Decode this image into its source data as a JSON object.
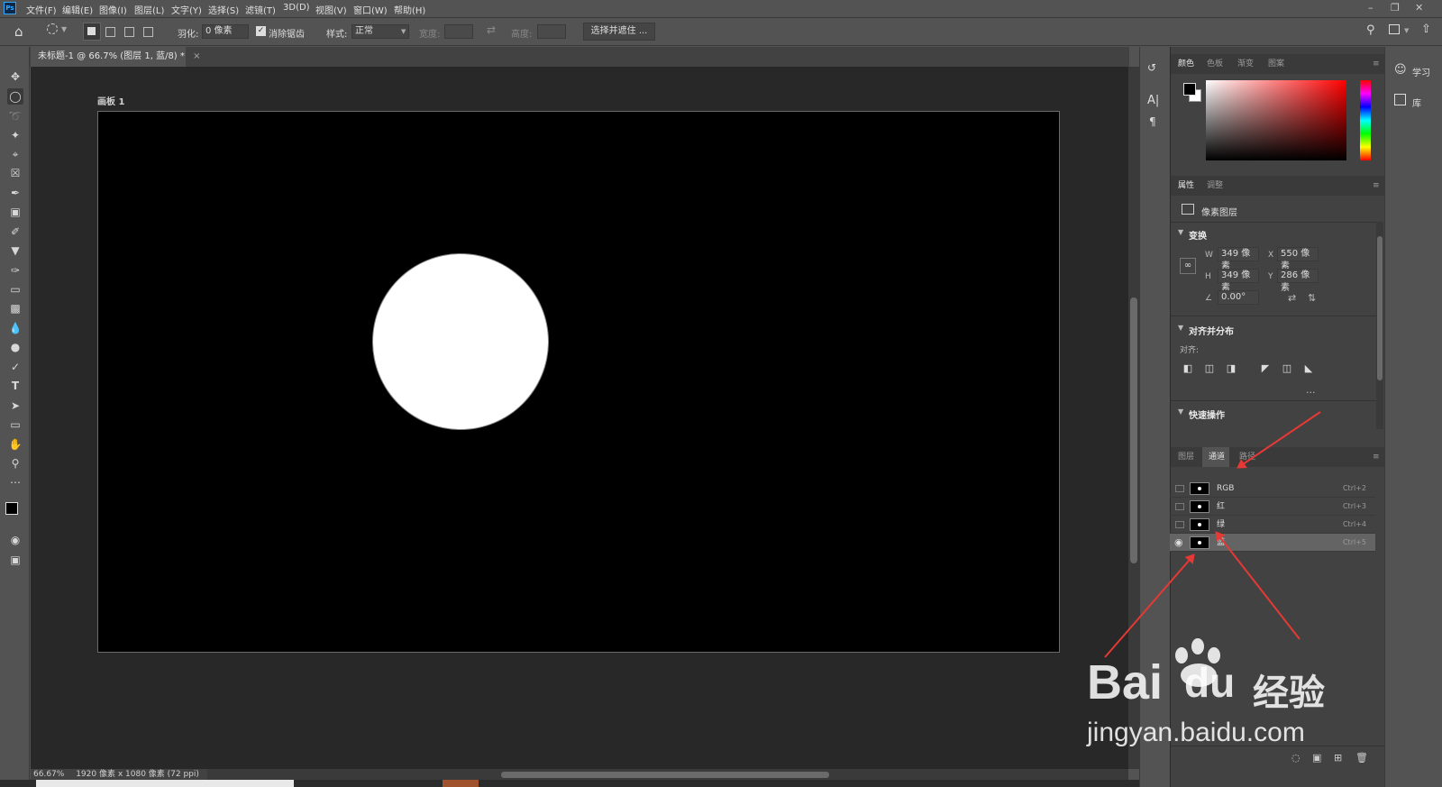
{
  "menubar": {
    "logo": "Ps",
    "items": [
      "文件(F)",
      "编辑(E)",
      "图像(I)",
      "图层(L)",
      "文字(Y)",
      "选择(S)",
      "滤镜(T)",
      "3D(D)",
      "视图(V)",
      "窗口(W)",
      "帮助(H)"
    ]
  },
  "options": {
    "feather_label": "羽化:",
    "feather_value": "0 像素",
    "antialias_label": "消除锯齿",
    "style_label": "样式:",
    "style_value": "正常",
    "width_label": "宽度:",
    "height_label": "高度:",
    "select_mask_label": "选择并遮住 ..."
  },
  "document": {
    "tab_title": "未标题-1 @ 66.7% (图层 1, 蓝/8) *",
    "close": "×",
    "artboard_label": "画板 1"
  },
  "status": {
    "zoom": "66.67%",
    "info": "1920 像素 x 1080 像素 (72 ppi)"
  },
  "color_panel": {
    "tabs": [
      "颜色",
      "色板",
      "渐变",
      "图案"
    ]
  },
  "properties": {
    "tabs": [
      "属性",
      "调整"
    ],
    "layer_kind": "像素图层",
    "transform_title": "变换",
    "w_label": "W",
    "w_value": "349 像素",
    "h_label": "H",
    "h_value": "349 像素",
    "x_label": "X",
    "x_value": "550 像素",
    "y_label": "Y",
    "y_value": "286 像素",
    "angle_value": "0.00°",
    "align_title": "对齐并分布",
    "align_label": "对齐:",
    "more": "...",
    "quick_title": "快速操作"
  },
  "channels_panel": {
    "tabs": [
      "图层",
      "通道",
      "路径"
    ],
    "rows": [
      {
        "name": "RGB",
        "shortcut": "Ctrl+2",
        "visible": false
      },
      {
        "name": "红",
        "shortcut": "Ctrl+3",
        "visible": false
      },
      {
        "name": "绿",
        "shortcut": "Ctrl+4",
        "visible": false
      },
      {
        "name": "蓝",
        "shortcut": "Ctrl+5",
        "visible": true
      }
    ]
  },
  "right_dock": {
    "learn": "学习",
    "library": "库"
  },
  "watermark": {
    "brand": "Bai",
    "brand2": "du",
    "brand_suffix": "经验",
    "url": "jingyan.baidu.com"
  },
  "colors": {
    "accent": "#e53935",
    "ui_bg": "#535353",
    "panel_bg": "#424242",
    "canvas_bg": "#282828"
  }
}
